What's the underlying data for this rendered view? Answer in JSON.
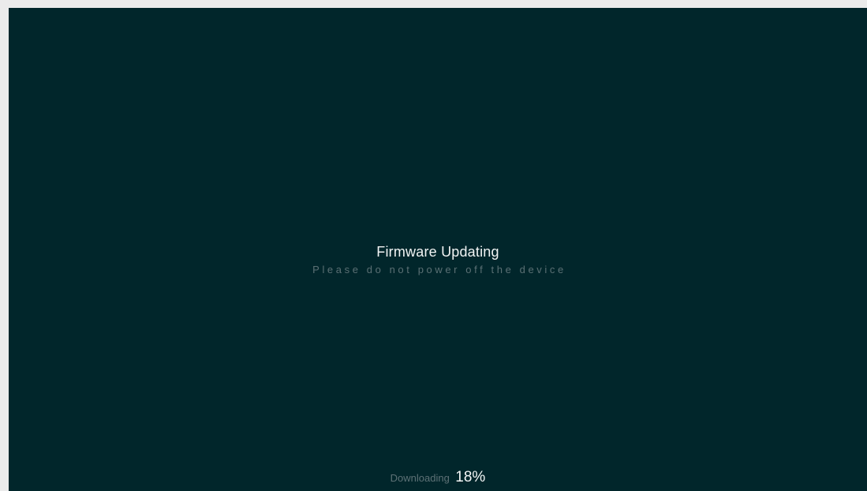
{
  "colors": {
    "frame": "#ebebeb",
    "screen_background": "#01262b",
    "title_text": "#f2f4f4",
    "muted_text": "#5b7074"
  },
  "update": {
    "title": "Firmware Updating",
    "warning": "Please do not power off the device"
  },
  "progress": {
    "label": "Downloading",
    "value_text": "18%",
    "percent": 18
  }
}
